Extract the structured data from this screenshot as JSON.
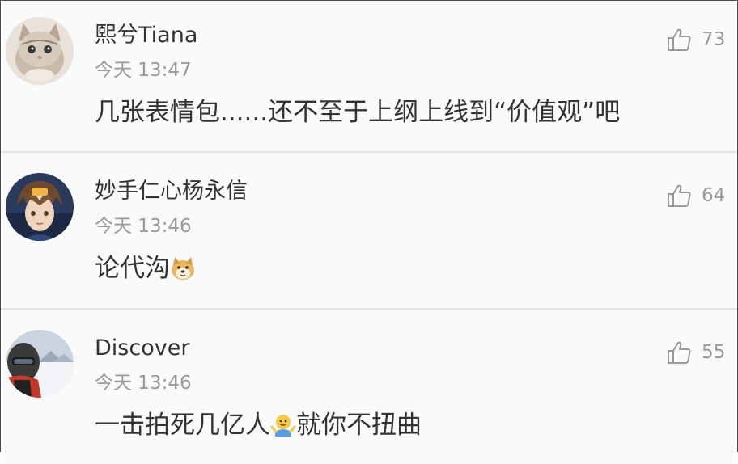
{
  "comments": [
    {
      "username": "熙兮Tiana",
      "time": "今天 13:47",
      "likes": "73",
      "text": "几张表情包......还不至于上纲上线到“价值观”吧",
      "avatar_icon": "kitten-avatar"
    },
    {
      "username": "妙手仁心杨永信",
      "time": "今天 13:46",
      "likes": "64",
      "text": "论代沟",
      "emoji_icon": "doge-emoji",
      "avatar_icon": "anime-character-avatar"
    },
    {
      "username": "Discover",
      "time": "今天 13:46",
      "likes": "55",
      "text_before": "一击拍死几亿人",
      "emoji_icon": "shrug-emoji",
      "text_after": "就你不扭曲",
      "avatar_icon": "skier-avatar"
    }
  ],
  "like_icon": "thumbs-up-icon",
  "colors": {
    "text": "#333333",
    "meta": "#9a9a9a",
    "divider": "#e3e3e3",
    "background": "#fafafa"
  }
}
